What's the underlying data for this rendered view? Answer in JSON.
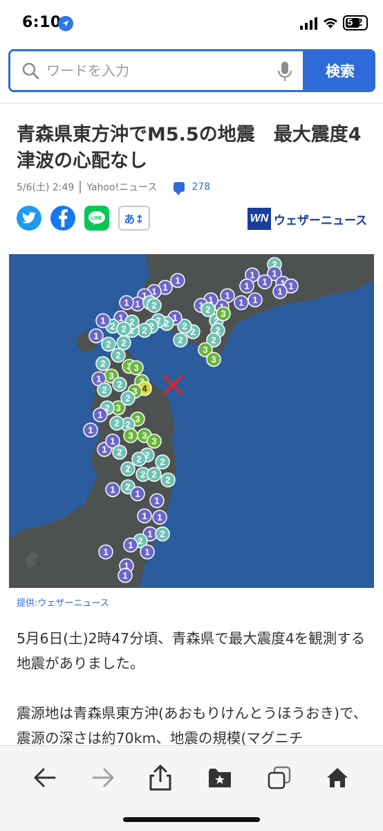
{
  "status_bar": {
    "time": "6:10",
    "battery": "52",
    "battery_first": "5",
    "battery_second": "2"
  },
  "search": {
    "placeholder": "ワードを入力",
    "button_label": "検索"
  },
  "article": {
    "title": "青森県東方沖でM5.5の地震　最大震度4　津波の心配なし",
    "date": "5/6(土) 2:49",
    "source": "Yahoo!ニュース",
    "comment_count": "278",
    "font_size_label": "あ↕",
    "provider_logo_mark": "WN",
    "provider_logo_text": "ウェザーニュース",
    "image_credit": "提供:ウェザーニュース",
    "paragraph1": "5月6日(土)2時47分頃、青森県で最大震度4を観測する地震がありました。",
    "paragraph2": "震源地は青森県東方沖(あおもりけんとうほうおき)で、震源の深さは約70km、地震の規模(マグニチ"
  },
  "map": {
    "epicenter_marker": "×",
    "colors": {
      "sea": "#2b5d9e",
      "land": "#4d5150",
      "intensity_1": "#6b67c7",
      "intensity_2": "#6fc2b4",
      "intensity_3": "#6ab53c",
      "intensity_4": "#d7d740",
      "epicenter": "#d6262a"
    }
  },
  "colors": {
    "accent": "#2f6bd8",
    "twitter": "#1d9bf0",
    "facebook": "#1877f2",
    "line": "#06c755",
    "weathernews": "#1a3e9c"
  },
  "toolbar": {
    "icons": [
      "back-arrow-icon",
      "forward-arrow-icon",
      "share-icon",
      "bookmarks-icon",
      "tabs-icon",
      "home-icon"
    ]
  }
}
